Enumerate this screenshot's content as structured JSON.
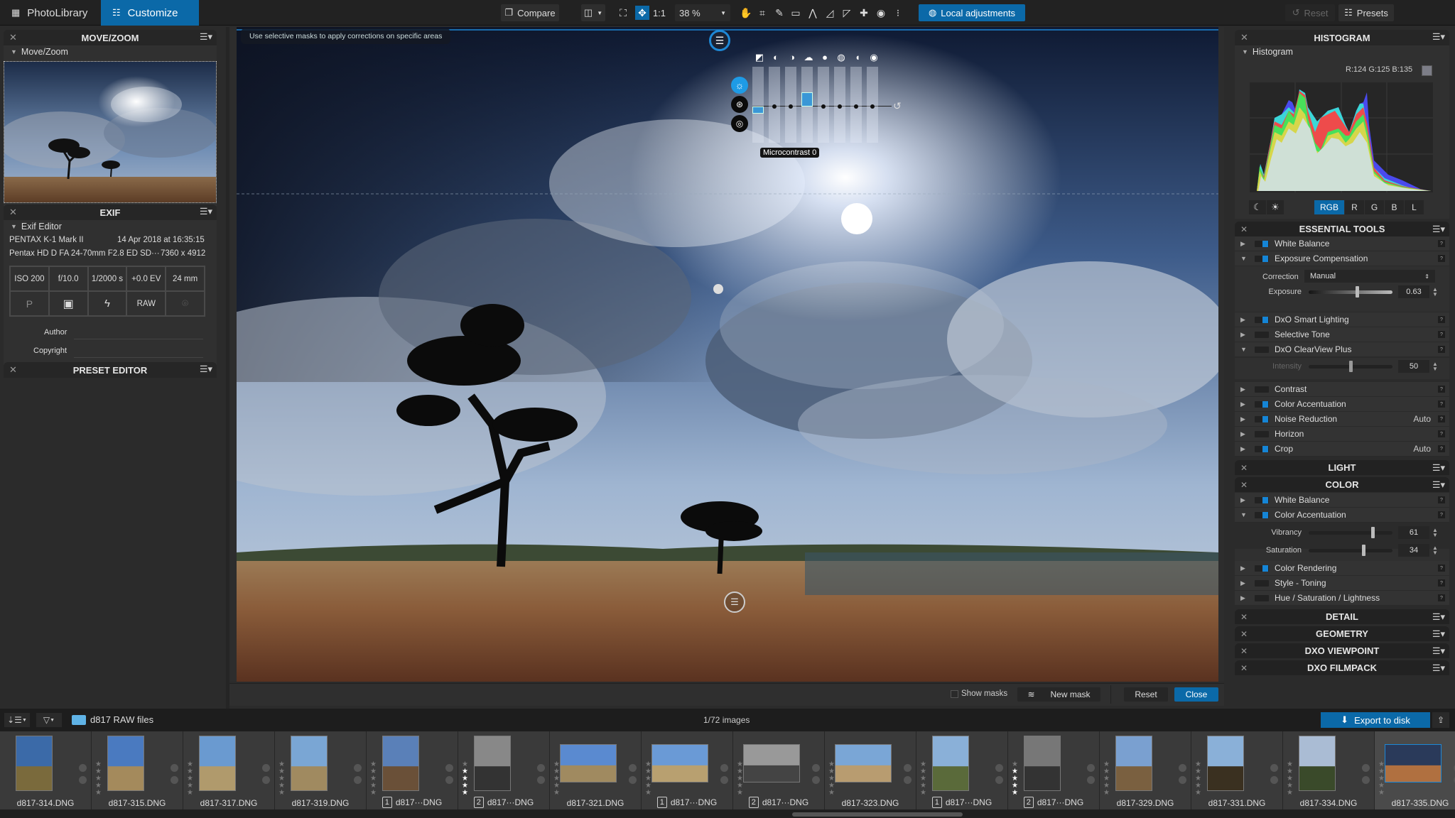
{
  "topbar": {
    "tabs": [
      {
        "label": "PhotoLibrary",
        "icon": "grid-icon",
        "active": false
      },
      {
        "label": "Customize",
        "icon": "sliders-icon",
        "active": true
      }
    ],
    "compare_label": "Compare",
    "one_to_one": "1:1",
    "zoom_value": "38 %",
    "local_adjustments_label": "Local adjustments",
    "reset_label": "Reset",
    "presets_label": "Presets",
    "accent": "#0b69a8"
  },
  "left": {
    "move_zoom": {
      "title": "MOVE/ZOOM",
      "sub": "Move/Zoom"
    },
    "exif": {
      "title": "EXIF",
      "sub": "Exif Editor",
      "camera": "PENTAX K-1 Mark II",
      "date": "14 Apr 2018 at 16:35:15",
      "lens": "Pentax HD D FA 24-70mm F2.8 ED SD···",
      "dimensions": "7360 x 4912",
      "grid": [
        "ISO 200",
        "f/10.0",
        "1/2000 s",
        "+0.0 EV",
        "24 mm"
      ],
      "grid2": [
        "P",
        "metering-icon",
        "flash-off-icon",
        "RAW",
        "location-icon"
      ],
      "author_label": "Author",
      "copyright_label": "Copyright",
      "author_value": "",
      "copyright_value": ""
    },
    "preset_editor": {
      "title": "PRESET EDITOR"
    }
  },
  "viewer": {
    "hint": "Use selective masks to apply corrections on specific areas",
    "equalizer": {
      "tooltip": "Microcontrast 0",
      "columns": [
        {
          "icon": "exposure-icon",
          "value": -0.1
        },
        {
          "icon": "contrast-icon",
          "value": 0
        },
        {
          "icon": "microcontrast-icon",
          "value": 0
        },
        {
          "icon": "clearview-icon",
          "value": 0.2
        },
        {
          "icon": "highlights-icon",
          "value": 0
        },
        {
          "icon": "midtones-icon",
          "value": 0
        },
        {
          "icon": "shadows-icon",
          "value": 0
        },
        {
          "icon": "blacks-icon",
          "value": 0
        }
      ]
    },
    "bottom": {
      "show_masks_label": "Show masks",
      "show_masks_checked": false,
      "new_mask_label": "New mask",
      "reset_label": "Reset",
      "close_label": "Close"
    }
  },
  "right": {
    "histogram": {
      "title": "HISTOGRAM",
      "sub": "Histogram",
      "readout": "R:124 G:125 B:135",
      "swatch": "#7c7d87",
      "channels": [
        "RGB",
        "R",
        "G",
        "B",
        "L"
      ],
      "active_channel": "RGB"
    },
    "essential": {
      "title": "ESSENTIAL TOOLS",
      "items": [
        {
          "label": "White Balance",
          "on": true,
          "open": false,
          "aux": ""
        },
        {
          "label": "Exposure Compensation",
          "on": true,
          "open": true,
          "aux": ""
        },
        {
          "label": "DxO Smart Lighting",
          "on": true,
          "open": false,
          "aux": ""
        },
        {
          "label": "Selective Tone",
          "on": false,
          "open": false,
          "aux": ""
        },
        {
          "label": "DxO ClearView Plus",
          "on": false,
          "open": true,
          "aux": ""
        },
        {
          "label": "Contrast",
          "on": false,
          "open": false,
          "aux": ""
        },
        {
          "label": "Color Accentuation",
          "on": true,
          "open": false,
          "aux": ""
        },
        {
          "label": "Noise Reduction",
          "on": true,
          "open": false,
          "aux": "Auto"
        },
        {
          "label": "Horizon",
          "on": false,
          "open": false,
          "aux": ""
        },
        {
          "label": "Crop",
          "on": true,
          "open": false,
          "aux": "Auto"
        }
      ],
      "correction_label": "Correction",
      "correction_value": "Manual",
      "exposure_label": "Exposure",
      "exposure_value": "0.63",
      "exposure_fraction": 0.58,
      "intensity_label": "Intensity",
      "intensity_value": "50",
      "intensity_fraction": 0.5
    },
    "light": {
      "title": "LIGHT"
    },
    "color": {
      "title": "COLOR",
      "items": [
        {
          "label": "White Balance",
          "on": true
        },
        {
          "label": "Color Accentuation",
          "on": true
        },
        {
          "label": "Color Rendering",
          "on": true
        },
        {
          "label": "Style - Toning",
          "on": false
        },
        {
          "label": "Hue / Saturation / Lightness",
          "on": false
        }
      ],
      "vibrancy_label": "Vibrancy",
      "vibrancy_value": "61",
      "vibrancy_fraction": 0.76,
      "saturation_label": "Saturation",
      "saturation_value": "34",
      "saturation_fraction": 0.65
    },
    "collapsed": [
      "DETAIL",
      "GEOMETRY",
      "DXO VIEWPOINT",
      "DXO FILMPACK"
    ]
  },
  "filmstrip": {
    "folder": "d817 RAW files",
    "count": "1/72 images",
    "export_label": "Export to disk",
    "items": [
      {
        "name": "d817-314.DNG",
        "vc": "",
        "stars": 0,
        "orient": "p",
        "sel": false
      },
      {
        "name": "d817-315.DNG",
        "vc": "",
        "stars": 0,
        "orient": "p",
        "sel": false
      },
      {
        "name": "d817-317.DNG",
        "vc": "",
        "stars": 0,
        "orient": "p",
        "sel": false
      },
      {
        "name": "d817-319.DNG",
        "vc": "",
        "stars": 0,
        "orient": "p",
        "sel": false
      },
      {
        "name": "d817···DNG",
        "vc": "1",
        "stars": 0,
        "orient": "p",
        "sel": false
      },
      {
        "name": "d817···DNG",
        "vc": "2",
        "stars": 4,
        "orient": "p",
        "sel": false
      },
      {
        "name": "d817-321.DNG",
        "vc": "",
        "stars": 0,
        "orient": "l",
        "sel": false
      },
      {
        "name": "d817···DNG",
        "vc": "1",
        "stars": 0,
        "orient": "l",
        "sel": false
      },
      {
        "name": "d817···DNG",
        "vc": "2",
        "stars": 0,
        "orient": "l",
        "sel": false
      },
      {
        "name": "d817-323.DNG",
        "vc": "",
        "stars": 0,
        "orient": "l",
        "sel": false
      },
      {
        "name": "d817···DNG",
        "vc": "1",
        "stars": 0,
        "orient": "p",
        "sel": false
      },
      {
        "name": "d817···DNG",
        "vc": "2",
        "stars": 4,
        "orient": "p",
        "sel": false
      },
      {
        "name": "d817-329.DNG",
        "vc": "",
        "stars": 0,
        "orient": "p",
        "sel": false
      },
      {
        "name": "d817-331.DNG",
        "vc": "",
        "stars": 0,
        "orient": "p",
        "sel": false
      },
      {
        "name": "d817-334.DNG",
        "vc": "",
        "stars": 0,
        "orient": "p",
        "sel": false
      },
      {
        "name": "d817-335.DNG",
        "vc": "",
        "stars": 0,
        "orient": "l",
        "sel": true
      }
    ]
  }
}
